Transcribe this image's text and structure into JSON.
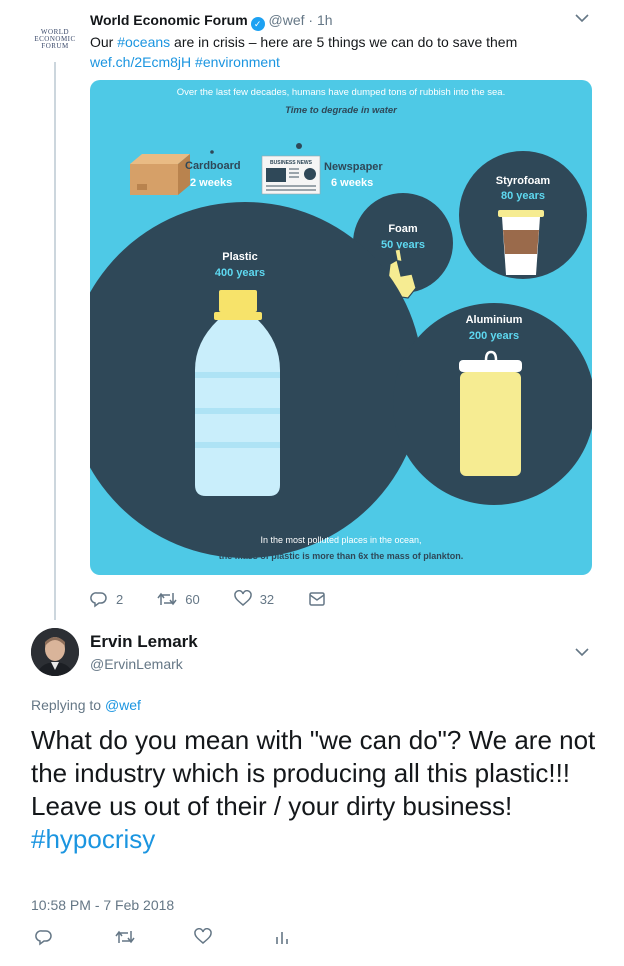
{
  "tweet1": {
    "author_name": "World Economic Forum",
    "avatar_lines": [
      "WORLD",
      "ECONOMIC",
      "FORUM"
    ],
    "handle": "@wef",
    "separator": "·",
    "time": "1h",
    "text_before": "Our ",
    "hashtag_oceans": "#oceans",
    "text_after": " are in crisis – here are 5 things we can do to save them",
    "link": "wef.ch/2Ecm8jH",
    "hashtag_environment": "#environment",
    "counts": {
      "replies": "2",
      "retweets": "60",
      "likes": "32"
    }
  },
  "infographic": {
    "intro": "Over the last few decades, humans have dumped tons of rubbish into the sea.",
    "subtitle": "Time to degrade in water",
    "newspaper_print": "BUSINESS NEWS",
    "items": [
      {
        "name": "Cardboard",
        "duration": "2 weeks"
      },
      {
        "name": "Newspaper",
        "duration": "6 weeks"
      },
      {
        "name": "Styrofoam",
        "duration": "80 years"
      },
      {
        "name": "Foam",
        "duration": "50 years"
      },
      {
        "name": "Plastic",
        "duration": "400 years"
      },
      {
        "name": "Aluminium",
        "duration": "200 years"
      }
    ],
    "footer_line1": "In the most polluted places in the ocean,",
    "footer_line2": "the mass of plastic is more than 6x the mass of plankton.",
    "colors": {
      "background": "#4ec9e6",
      "circle": "#2f4858",
      "label_accent": "#5ed8f0",
      "can": "#f6ec92",
      "bottle": "#c9eefb",
      "cap": "#f7e36a"
    }
  },
  "tweet2": {
    "author_name": "Ervin Lemark",
    "handle": "@ErvinLemark",
    "replying_prefix": "Replying to",
    "replying_to": "@wef",
    "text": "What do you mean with \"we can do\"? We are not the industry which is producing all this plastic!!! Leave us out of their / your dirty business!",
    "hashtag": "#hypocrisy",
    "timestamp": "10:58 PM - 7 Feb 2018"
  },
  "icons": {
    "reply": "reply-icon",
    "retweet": "retweet-icon",
    "like": "heart-icon",
    "dm": "envelope-icon",
    "analytics": "analytics-icon",
    "more": "chevron-down-icon",
    "verified": "verified-badge-icon"
  }
}
